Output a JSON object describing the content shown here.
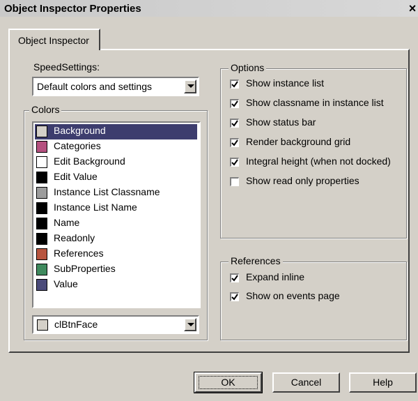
{
  "window": {
    "title": "Object Inspector Properties",
    "close_glyph": "×"
  },
  "tabs": [
    {
      "label": "Object Inspector",
      "active": true
    }
  ],
  "speed_settings": {
    "label": "SpeedSettings:",
    "value": "Default colors and settings"
  },
  "colors": {
    "legend": "Colors",
    "items": [
      {
        "label": "Background",
        "color": "#d4d0c8",
        "selected": true
      },
      {
        "label": "Categories",
        "color": "#b5517f",
        "selected": false
      },
      {
        "label": "Edit Background",
        "color": "#ffffff",
        "selected": false
      },
      {
        "label": "Edit Value",
        "color": "#000000",
        "selected": false
      },
      {
        "label": "Instance List Classname",
        "color": "#9c9c9c",
        "selected": false
      },
      {
        "label": "Instance List Name",
        "color": "#000000",
        "selected": false
      },
      {
        "label": "Name",
        "color": "#000000",
        "selected": false
      },
      {
        "label": "Readonly",
        "color": "#000000",
        "selected": false
      },
      {
        "label": "References",
        "color": "#b8553f",
        "selected": false
      },
      {
        "label": "SubProperties",
        "color": "#3f8a5e",
        "selected": false
      },
      {
        "label": "Value",
        "color": "#4a4a7a",
        "selected": false
      }
    ],
    "picker_value": "clBtnFace",
    "picker_color": "#d4d0c8"
  },
  "options": {
    "legend": "Options",
    "items": [
      {
        "label": "Show instance list",
        "checked": true
      },
      {
        "label": "Show classname in instance list",
        "checked": true
      },
      {
        "label": "Show status bar",
        "checked": true
      },
      {
        "label": "Render background grid",
        "checked": true
      },
      {
        "label": "Integral height (when not docked)",
        "checked": true
      },
      {
        "label": "Show read only properties",
        "checked": false
      }
    ]
  },
  "references": {
    "legend": "References",
    "items": [
      {
        "label": "Expand inline",
        "checked": true
      },
      {
        "label": "Show on events page",
        "checked": true
      }
    ]
  },
  "buttons": {
    "ok": "OK",
    "cancel": "Cancel",
    "help": "Help"
  }
}
